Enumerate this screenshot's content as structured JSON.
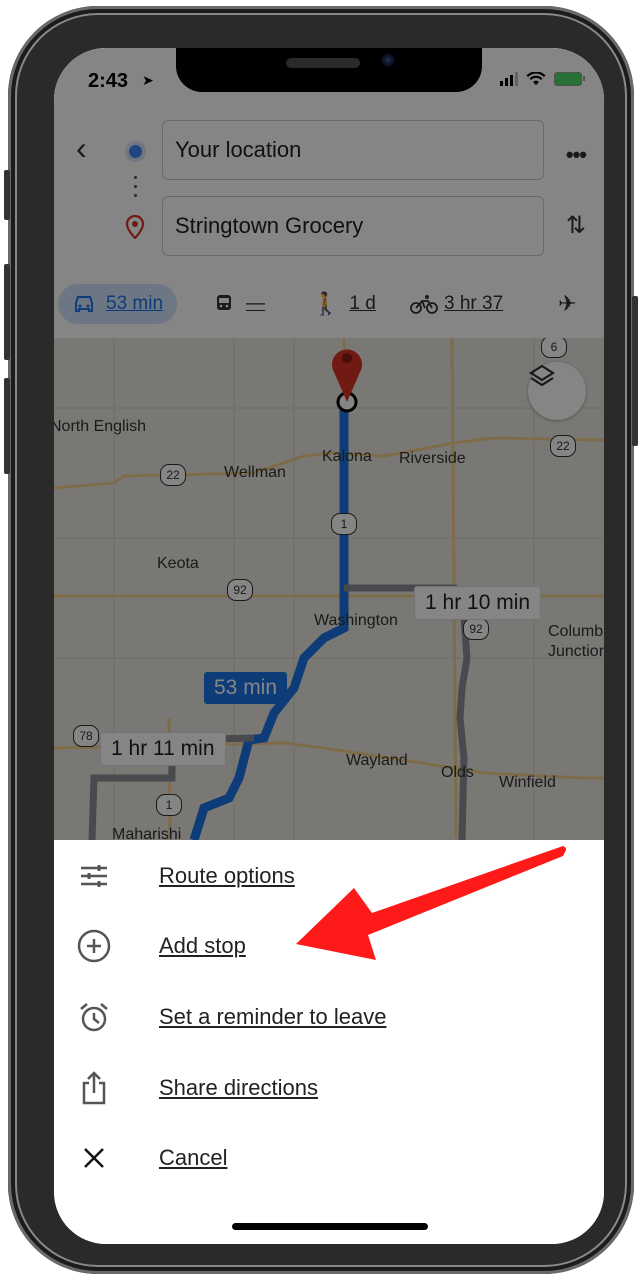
{
  "status_bar": {
    "time": "2:43",
    "location_icon": "location-arrow-icon",
    "signal_icon": "signal-icon",
    "wifi_icon": "wifi-icon",
    "battery_icon": "battery-charging-icon"
  },
  "directions": {
    "origin": "Your location",
    "destination": "Stringtown Grocery",
    "back_icon": "back-chevron-icon",
    "more_icon": "more-dots-icon",
    "swap_icon": "swap-icon"
  },
  "travel_modes": [
    {
      "mode": "drive",
      "icon": "car-icon",
      "label": "53 min",
      "active": true
    },
    {
      "mode": "transit",
      "icon": "train-icon",
      "label": "—",
      "active": false
    },
    {
      "mode": "walk",
      "icon": "walk-icon",
      "label": "1 d",
      "active": false
    },
    {
      "mode": "bike",
      "icon": "bike-icon",
      "label": "3 hr 37",
      "active": false
    },
    {
      "mode": "flight",
      "icon": "plane-icon",
      "label": "",
      "active": false
    }
  ],
  "map": {
    "places": [
      "North English",
      "Wellman",
      "Kalona",
      "Riverside",
      "Keota",
      "Washington",
      "Wayland",
      "Olds",
      "Winfield",
      "Columbus Junction",
      "Maharishi"
    ],
    "highways": [
      "6",
      "22",
      "22",
      "1",
      "92",
      "92",
      "78",
      "1"
    ],
    "route_bubbles": {
      "primary": "53 min",
      "alt1": "1 hr 10 min",
      "alt2": "1 hr 11 min"
    },
    "route_color": "#1a73e8",
    "alt_route_color": "#8a8f96"
  },
  "sheet": {
    "items": [
      {
        "icon": "sliders-icon",
        "label": "Route options"
      },
      {
        "icon": "add-circle-icon",
        "label": "Add stop"
      },
      {
        "icon": "alarm-icon",
        "label": "Set a reminder to leave"
      },
      {
        "icon": "share-icon",
        "label": "Share directions"
      },
      {
        "icon": "close-icon",
        "label": "Cancel"
      }
    ]
  },
  "annotation": {
    "color": "#ff1a1a"
  }
}
